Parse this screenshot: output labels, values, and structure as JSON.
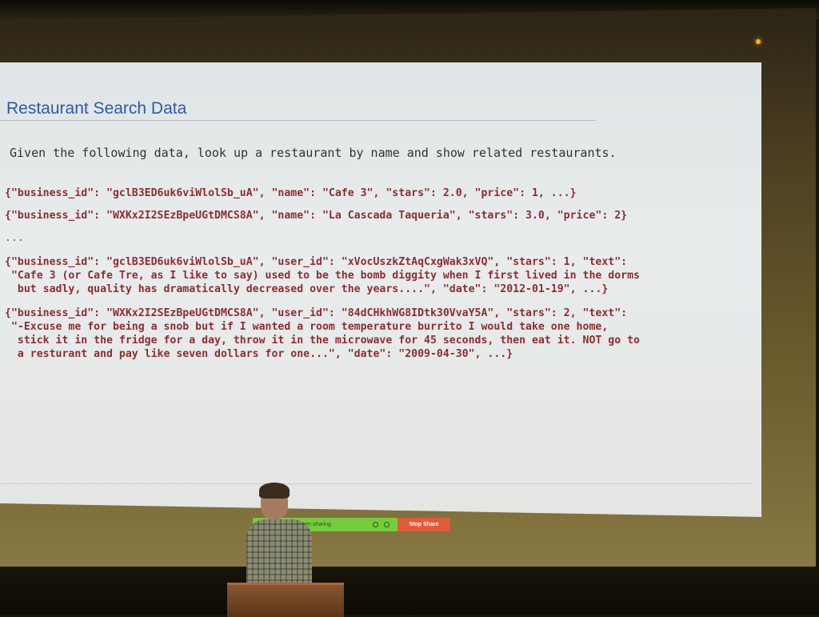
{
  "slide": {
    "title": "Restaurant Search Data",
    "intro": "Given the following data, look up a restaurant by name and show related restaurants.",
    "business_records": [
      "{\"business_id\": \"gclB3ED6uk6viWlolSb_uA\", \"name\": \"Cafe 3\", \"stars\": 2.0, \"price\": 1, ...}",
      "{\"business_id\": \"WXKx2I2SEzBpeUGtDMCS8A\", \"name\": \"La Cascada Taqueria\", \"stars\": 3.0, \"price\": 2}"
    ],
    "ellipsis": "...",
    "review_1": [
      "{\"business_id\": \"gclB3ED6uk6viWlolSb_uA\", \"user_id\": \"xVocUszkZtAqCxgWak3xVQ\", \"stars\": 1, \"text\":",
      " \"Cafe 3 (or Cafe Tre, as I like to say) used to be the bomb diggity when I first lived in the dorms",
      "  but sadly, quality has dramatically decreased over the years....\", \"date\": \"2012-01-19\", ...}"
    ],
    "review_2": [
      "{\"business_id\": \"WXKx2I2SEzBpeUGtDMCS8A\", \"user_id\": \"84dCHkhWG8IDtk30VvaY5A\", \"stars\": 2, \"text\":",
      " \"-Excuse me for being a snob but if I wanted a room temperature burrito I would take one home,",
      "  stick it in the fridge for a day, throw it in the microwave for 45 seconds, then eat it. NOT go to",
      "  a resturant and pay like seven dollars for one...\", \"date\": \"2009-04-30\", ...}"
    ]
  },
  "zoom_bar": {
    "sharing_label": "screen sharing",
    "stop_share_label": "Stop Share"
  },
  "colors": {
    "title": "#2f5aa8",
    "code": "#8e2d33",
    "share_bar": "#74cc3c",
    "stop_share": "#e35a3a"
  }
}
